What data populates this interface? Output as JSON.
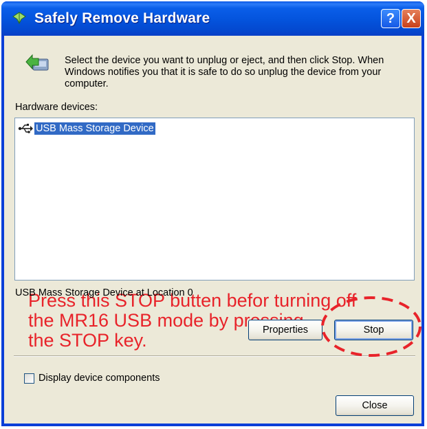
{
  "window": {
    "title": "Safely Remove Hardware",
    "help_label": "?",
    "close_label": "X"
  },
  "instruction": "Select the device you want to unplug or eject, and then click Stop. When Windows notifies you that it is safe to do so unplug the device from your computer.",
  "hardware_devices_label": "Hardware devices:",
  "devices": [
    {
      "label": "USB Mass Storage Device",
      "icon": "usb-icon",
      "selected": true
    }
  ],
  "annotation": "Press this STOP butten befor turning off\nthe MR16 USB mode by pressing\nthe STOP key.",
  "location_text": "USB Mass Storage Device at Location 0",
  "buttons": {
    "properties": "Properties",
    "stop": "Stop",
    "close": "Close"
  },
  "checkbox": {
    "label": "Display device components",
    "checked": false
  },
  "colors": {
    "titlebar": "#0453dc",
    "selection": "#316ac5",
    "annotation": "#e8232a"
  }
}
